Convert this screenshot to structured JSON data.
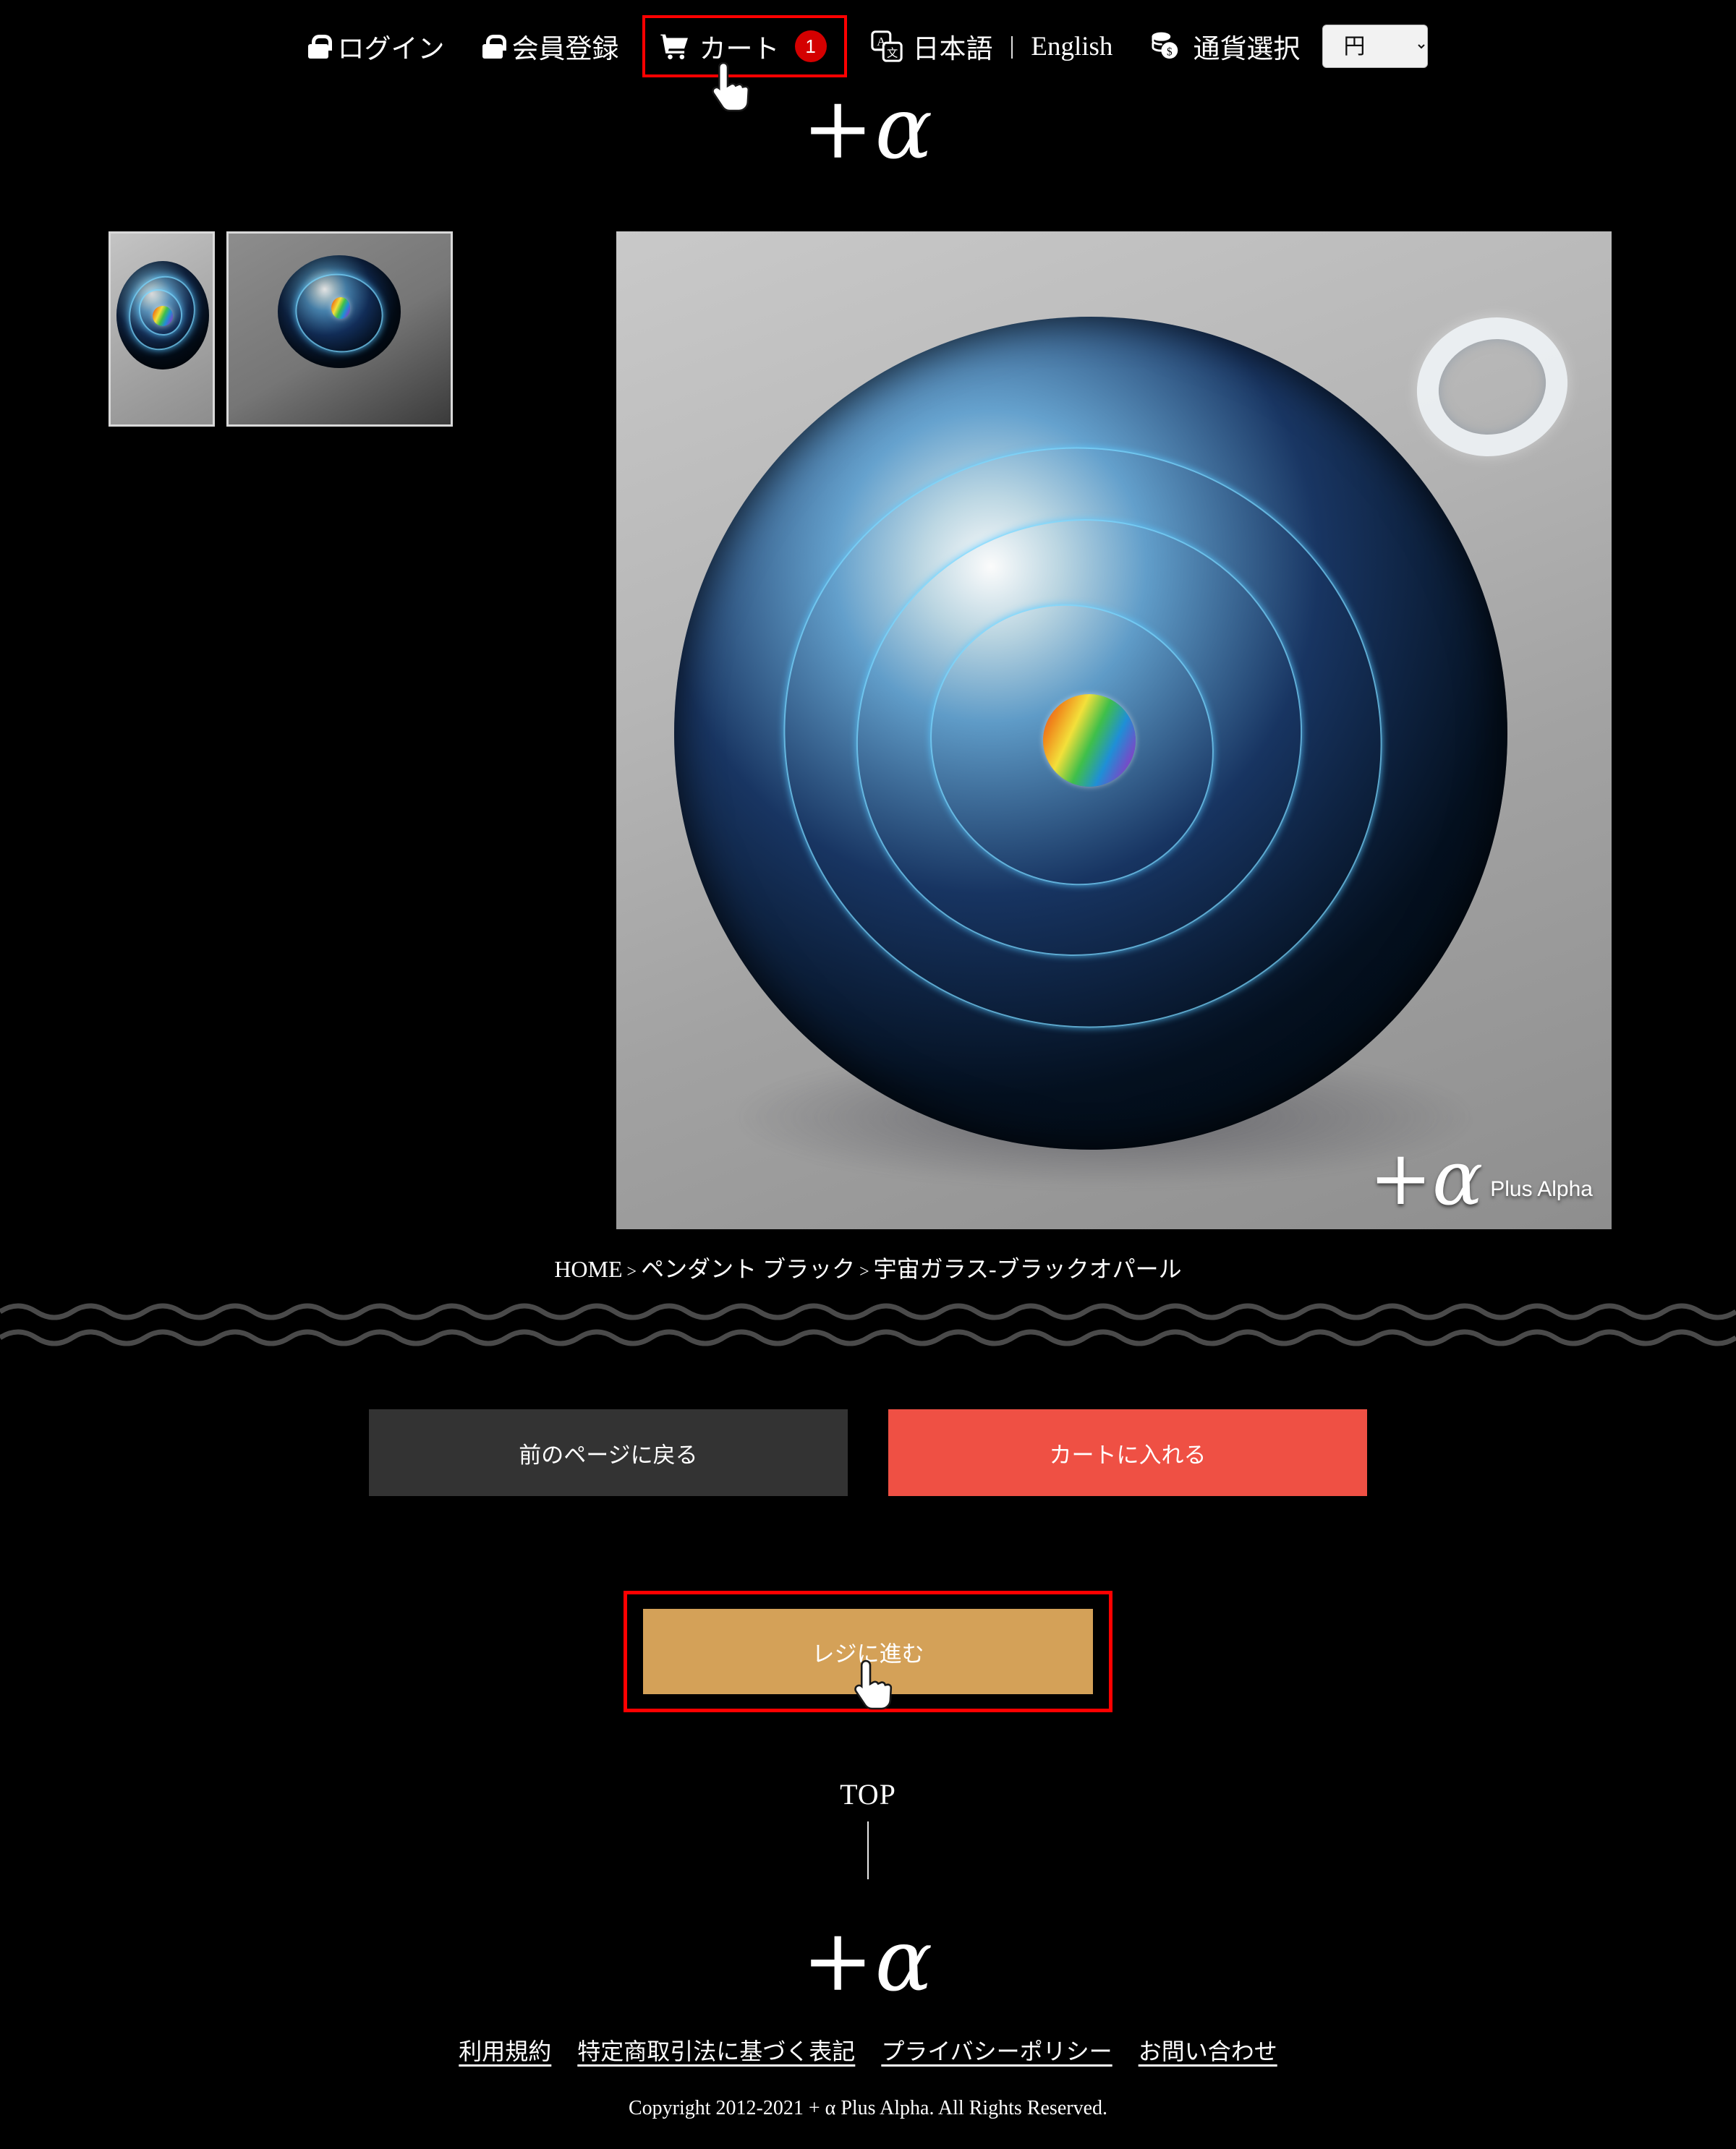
{
  "header": {
    "login": {
      "label": "ログイン",
      "icon": "lock-icon"
    },
    "register": {
      "label": "会員登録",
      "icon": "lock-icon"
    },
    "cart": {
      "label": "カート",
      "icon": "shopping-cart-icon",
      "badge_count": "1",
      "highlight_color": "#ff0000"
    },
    "language": {
      "icon": "translate-icon",
      "japanese": "日本語",
      "separator": "|",
      "english": "English"
    },
    "currency": {
      "icon": "coins-icon",
      "label": "通貨選択",
      "selected": "円",
      "options": [
        "円"
      ]
    }
  },
  "brand": {
    "logo_plus": "+",
    "logo_alpha": "α",
    "name": "Plus Alpha"
  },
  "gallery": {
    "thumbnails": [
      {
        "alt": "宇宙ガラス-ブラックオパール ペンダント 正面"
      },
      {
        "alt": "宇宙ガラス-ブラックオパール ペンダント 斜め"
      }
    ],
    "main_image": {
      "alt": "宇宙ガラス-ブラックオパール ペンダント 拡大"
    },
    "watermark": {
      "logo_plus": "+",
      "logo_alpha": "α",
      "sub": "Plus Alpha"
    }
  },
  "breadcrumb": {
    "home": "HOME",
    "sep1": ">",
    "category": "ペンダント ブラック",
    "sep2": ">",
    "product": "宇宙ガラス-ブラックオパール"
  },
  "actions": {
    "back": {
      "label": "前のページに戻る",
      "color": "#333333"
    },
    "add_to_cart": {
      "label": "カートに入れる",
      "color": "#ef5044"
    },
    "checkout": {
      "label": "レジに進む",
      "color": "#d4a158",
      "highlight_color": "#ff0000"
    }
  },
  "top_link": {
    "label": "TOP"
  },
  "footer": {
    "links": [
      {
        "label": "利用規約"
      },
      {
        "label": "特定商取引法に基づく表記"
      },
      {
        "label": "プライバシーポリシー"
      },
      {
        "label": "お問い合わせ"
      }
    ],
    "copyright": "Copyright 2012-2021 + α  Plus Alpha. All Rights Reserved."
  }
}
